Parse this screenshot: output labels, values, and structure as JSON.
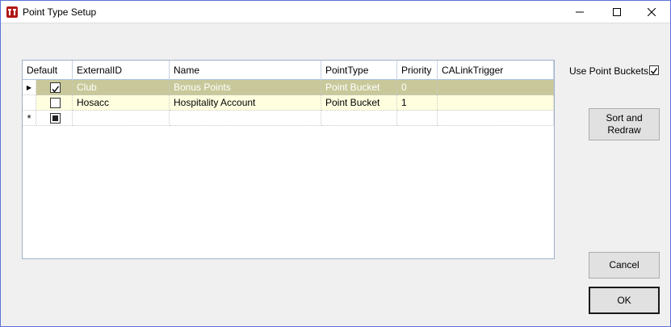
{
  "window": {
    "title": "Point Type Setup"
  },
  "grid": {
    "columns": [
      "Default",
      "ExternalID",
      "Name",
      "PointType",
      "Priority",
      "CALinkTrigger"
    ],
    "rows": [
      {
        "default": true,
        "external_id": "Club",
        "name": "Bonus Points",
        "point_type": "Point Bucket",
        "priority": "0",
        "calink": ""
      },
      {
        "default": false,
        "external_id": "Hosacc",
        "name": "Hospitality Account",
        "point_type": "Point Bucket",
        "priority": "1",
        "calink": ""
      }
    ],
    "current_row_marker": "▶",
    "new_row_marker": "*"
  },
  "options": {
    "use_point_buckets_label": "Use Point Buckets",
    "use_point_buckets_checked": true
  },
  "buttons": {
    "sort_label": "Sort and Redraw",
    "cancel_label": "Cancel",
    "ok_label": "OK"
  },
  "colors": {
    "selected_row": "#c8c89a",
    "alt_row": "#ffffe0",
    "app_icon": "#b01818"
  }
}
